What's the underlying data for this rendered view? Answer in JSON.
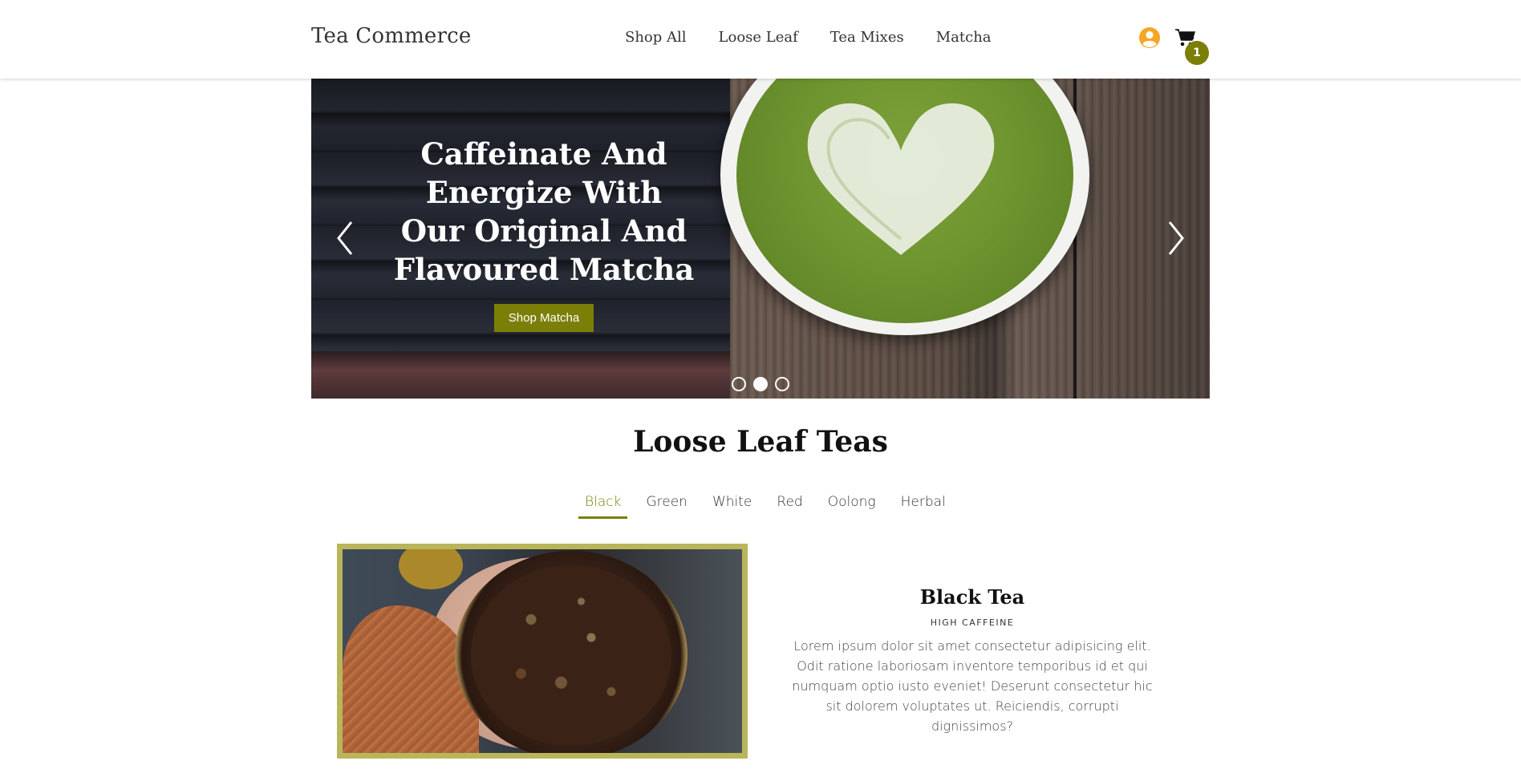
{
  "header": {
    "brand": "Tea Commerce",
    "nav": [
      "Shop All",
      "Loose Leaf",
      "Tea Mixes",
      "Matcha"
    ],
    "cart_count": "1",
    "account_color": "#f5a623",
    "accent_color": "#7b7f07"
  },
  "hero": {
    "title": "Caffeinate And Energize With Our Original And Flavoured Matcha",
    "button_label": "Shop Matcha",
    "slides_total": 3,
    "active_slide": 2
  },
  "section": {
    "title": "Loose Leaf Teas",
    "tabs": [
      "Black",
      "Green",
      "White",
      "Red",
      "Oolong",
      "Herbal"
    ],
    "active_tab": "Black"
  },
  "product": {
    "title": "Black Tea",
    "subtitle": "HIGH CAFFEINE",
    "description": "Lorem ipsum dolor sit amet consectetur adipisicing elit. Odit ratione laboriosam inventore temporibus id et qui numquam optio iusto eveniet! Deserunt consectetur hic sit dolorem voluptates ut. Reiciendis, corrupti dignissimos?"
  }
}
